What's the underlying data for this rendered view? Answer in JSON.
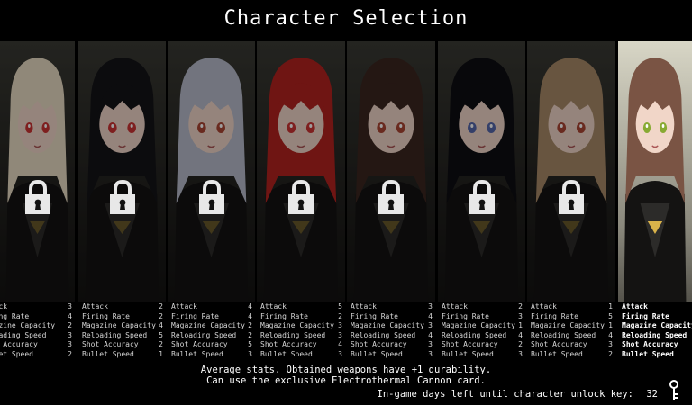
{
  "screen_title": "Character Selection",
  "stat_labels": [
    "Attack",
    "Firing Rate",
    "Magazine Capacity",
    "Reloading Speed",
    "Shot Accuracy",
    "Bullet Speed"
  ],
  "characters": [
    {
      "hair": "#e9dcc4",
      "eye": "#c33",
      "locked": true,
      "selected": false,
      "stats": {
        "labels": [
          "ttack",
          "iring Rate",
          "agazine Capacity",
          "eloading Speed",
          "hot Accuracy",
          "ullet Speed"
        ],
        "values": [
          "3",
          "4",
          "2",
          "3",
          "3",
          "2"
        ]
      }
    },
    {
      "hair": "#141418",
      "eye": "#c33",
      "locked": true,
      "selected": false,
      "stats": {
        "labels": [
          "Attack",
          "Firing Rate",
          "Magazine Capacity",
          "Reloading Speed",
          "Shot Accuracy",
          "Bullet Speed"
        ],
        "values": [
          "2",
          "2",
          "4",
          "5",
          "2",
          "1"
        ]
      }
    },
    {
      "hair": "#b8bccb",
      "eye": "#a43",
      "locked": true,
      "selected": false,
      "stats": {
        "labels": [
          "Attack",
          "Firing Rate",
          "Magazine Capacity",
          "Reloading Speed",
          "Shot Accuracy",
          "Bullet Speed"
        ],
        "values": [
          "4",
          "4",
          "2",
          "2",
          "5",
          "3"
        ]
      }
    },
    {
      "hair": "#b3221f",
      "eye": "#c33",
      "locked": true,
      "selected": false,
      "stats": {
        "labels": [
          "Attack",
          "Firing Rate",
          "Magazine Capacity",
          "Reloading Speed",
          "Shot Accuracy",
          "Bullet Speed"
        ],
        "values": [
          "5",
          "2",
          "3",
          "3",
          "4",
          "3"
        ]
      }
    },
    {
      "hair": "#3a2620",
      "eye": "#a43",
      "locked": true,
      "selected": false,
      "stats": {
        "labels": [
          "Attack",
          "Firing Rate",
          "Magazine Capacity",
          "Reloading Speed",
          "Shot Accuracy",
          "Bullet Speed"
        ],
        "values": [
          "3",
          "4",
          "3",
          "4",
          "3",
          "3"
        ]
      }
    },
    {
      "hair": "#0e0e12",
      "eye": "#56a",
      "locked": true,
      "selected": false,
      "stats": {
        "labels": [
          "Attack",
          "Firing Rate",
          "Magazine Capacity",
          "Reloading Speed",
          "Shot Accuracy",
          "Bullet Speed"
        ],
        "values": [
          "2",
          "3",
          "1",
          "4",
          "2",
          "3"
        ]
      }
    },
    {
      "hair": "#a88a68",
      "eye": "#a43",
      "locked": true,
      "selected": false,
      "stats": {
        "labels": [
          "Attack",
          "Firing Rate",
          "Magazine Capacity",
          "Reloading Speed",
          "Shot Accuracy",
          "Bullet Speed"
        ],
        "values": [
          "1",
          "5",
          "1",
          "4",
          "3",
          "2"
        ]
      }
    },
    {
      "hair": "#7a5444",
      "eye": "#8a3",
      "locked": false,
      "selected": true,
      "stats": {
        "labels": [
          "Attack",
          "Firing Rate",
          "Magazine Capacity",
          "Reloading Speed",
          "Shot Accuracy",
          "Bullet Speed"
        ],
        "values": [
          "",
          "",
          "",
          "",
          "",
          ""
        ]
      }
    }
  ],
  "description": {
    "line1": "Average stats. Obtained weapons have +1 durability.",
    "line2": "Can use the exclusive Electrothermal Cannon card."
  },
  "unlock": {
    "label": "In-game days left until character unlock key:",
    "days": "32"
  }
}
